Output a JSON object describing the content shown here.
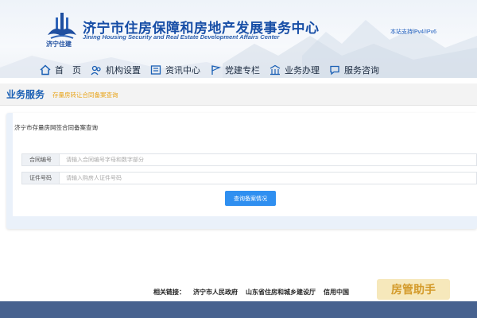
{
  "header": {
    "logo_caption": "济宁住建",
    "title": "济宁市住房保障和房地产发展事务中心",
    "subtitle": "Jining Housing Security and Real Estate Development Affairs Center",
    "ipv6_text": "本站支持IPv4/IPv6"
  },
  "nav": {
    "items": [
      {
        "label": "首　页",
        "icon": "home-icon"
      },
      {
        "label": "机构设置",
        "icon": "people-icon"
      },
      {
        "label": "资讯中心",
        "icon": "news-icon"
      },
      {
        "label": "党建专栏",
        "icon": "flag-icon"
      },
      {
        "label": "业务办理",
        "icon": "building-icon"
      },
      {
        "label": "服务咨询",
        "icon": "chat-icon"
      }
    ]
  },
  "business": {
    "title": "业务服务",
    "link": "存量房转让合同备案查询"
  },
  "query": {
    "panel_title": "济宁市存量房网签合同备案查询",
    "contract_label": "合同编号",
    "contract_placeholder": "请输入合同编号字母和数字部分",
    "id_label": "证件号码",
    "id_placeholder": "请输入购房人证件号码",
    "button_label": "查询备案情况"
  },
  "footer": {
    "prefix": "相关链接：",
    "links": [
      "济宁市人民政府",
      "山东省住房和城乡建设厅",
      "信用中国"
    ]
  },
  "watermark": "房管助手",
  "colors": {
    "brand_blue": "#174ea6",
    "accent_orange": "#e8a317",
    "button_blue": "#2f8ff0",
    "footer_bar": "#47628f"
  }
}
